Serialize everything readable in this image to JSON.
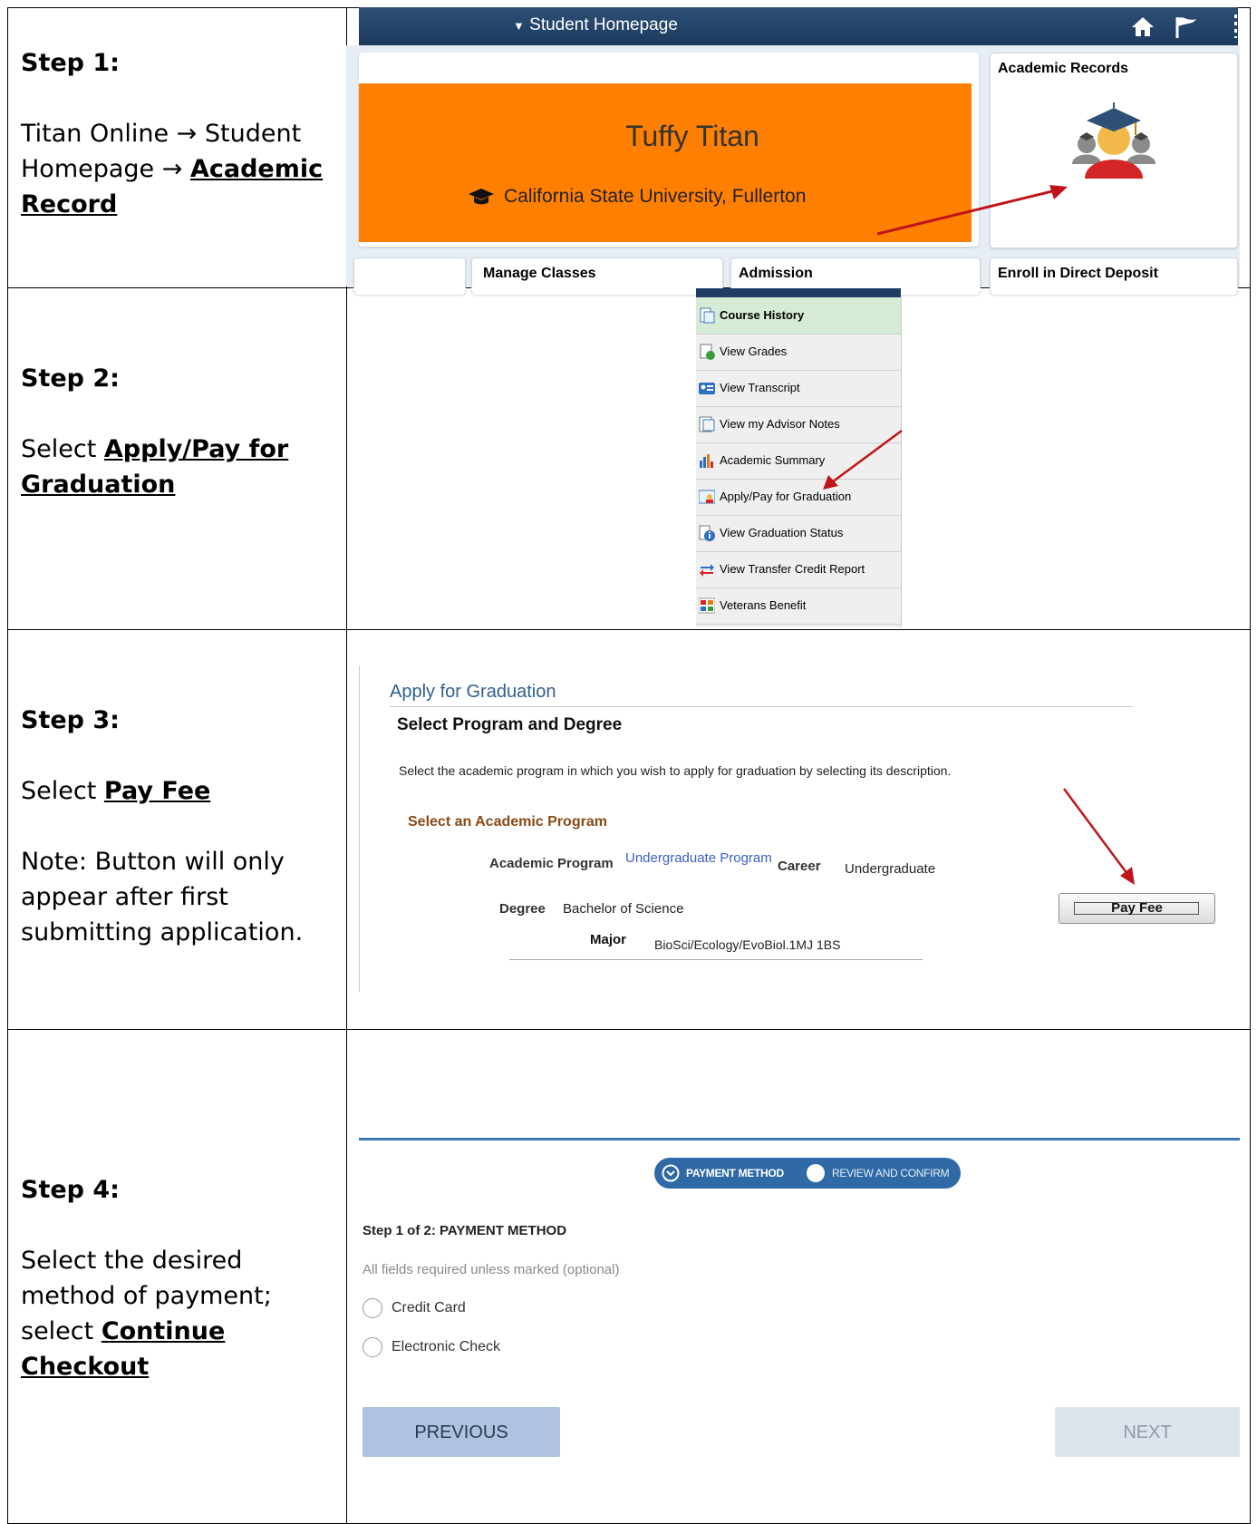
{
  "steps": [
    {
      "title": "Step 1:",
      "text_a": "Titan Online → Student Homepage → ",
      "link": "Academic Record",
      "text_b": ""
    },
    {
      "title": "Step 2:",
      "text_a": "Select ",
      "link": "Apply/Pay for Graduation",
      "text_b": ""
    },
    {
      "title": "Step 3:",
      "text_a": "Select ",
      "link": "Pay Fee",
      "text_b": "",
      "note": "Note: Button will only appear after first submitting application."
    },
    {
      "title": "Step 4:",
      "text_a": "Select the desired method of payment; select ",
      "link": "Continue Checkout",
      "text_b": ""
    }
  ],
  "step1_screen": {
    "nav_title": "Student Homepage",
    "profile_name": "Tuffy Titan",
    "university": "California State University, Fullerton",
    "tile_academic_records": "Academic Records",
    "tile_manage_classes": "Manage Classes",
    "tile_admission": "Admission",
    "tile_direct_deposit": "Enroll in Direct Deposit",
    "colors": {
      "nav": "#1f3d62",
      "banner": "#ff7f00",
      "arrow": "#c0141a"
    }
  },
  "step2_screen": {
    "items": [
      {
        "label": "Course History",
        "icon": "document-history-icon",
        "active": true
      },
      {
        "label": "View Grades",
        "icon": "grades-icon"
      },
      {
        "label": "View Transcript",
        "icon": "transcript-icon"
      },
      {
        "label": "View my Advisor Notes",
        "icon": "notes-icon"
      },
      {
        "label": "Academic Summary",
        "icon": "bar-chart-icon"
      },
      {
        "label": "Apply/Pay for Graduation",
        "icon": "graduation-apply-icon"
      },
      {
        "label": "View Graduation Status",
        "icon": "info-icon"
      },
      {
        "label": "View Transfer Credit Report",
        "icon": "transfer-arrows-icon"
      },
      {
        "label": "Veterans Benefit",
        "icon": "veterans-icon"
      }
    ]
  },
  "step3_screen": {
    "page_title": "Apply for Graduation",
    "section_title": "Select Program and Degree",
    "instructions": "Select the academic program in which you wish to apply for graduation by selecting its description.",
    "group_title": "Select an Academic Program",
    "program_label": "Academic Program",
    "program_value": "Undergraduate Program",
    "career_label": "Career",
    "career_value": "Undergraduate",
    "degree_label": "Degree",
    "degree_value": "Bachelor of Science",
    "major_label": "Major",
    "major_value": "BioSci/Ecology/EvoBiol.1MJ 1BS",
    "pay_fee_button": "Pay Fee"
  },
  "step4_screen": {
    "progress_step1": "PAYMENT METHOD",
    "progress_step2": "REVIEW AND CONFIRM",
    "heading": "Step 1 of 2: PAYMENT METHOD",
    "required_note": "All fields required unless marked (optional)",
    "option1": "Credit Card",
    "option2": "Electronic Check",
    "previous_button": "PREVIOUS",
    "next_button": "NEXT"
  }
}
